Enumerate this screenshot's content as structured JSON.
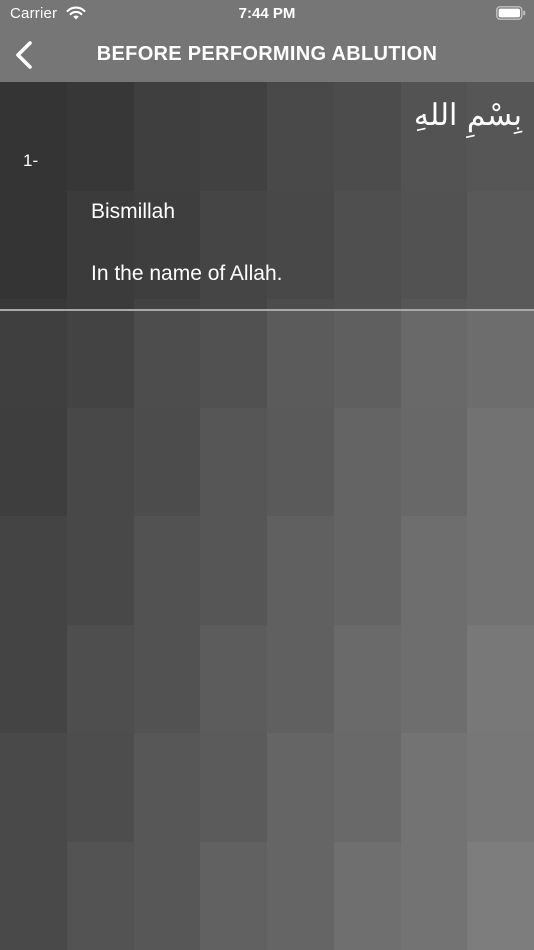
{
  "status_bar": {
    "carrier": "Carrier",
    "time": "7:44 PM",
    "wifi_icon": "wifi-icon",
    "battery_icon": "battery-icon"
  },
  "nav": {
    "title": "BEFORE PERFORMING ABLUTION",
    "back_icon": "chevron-left-icon"
  },
  "dua": {
    "number": "1-",
    "arabic": "بِسْمِ اللهِ",
    "transliteration": "Bismillah",
    "translation": "In the name of Allah."
  },
  "colors": {
    "nav_background": "#767676",
    "text": "#ffffff",
    "divider": "#a8a8a8"
  }
}
